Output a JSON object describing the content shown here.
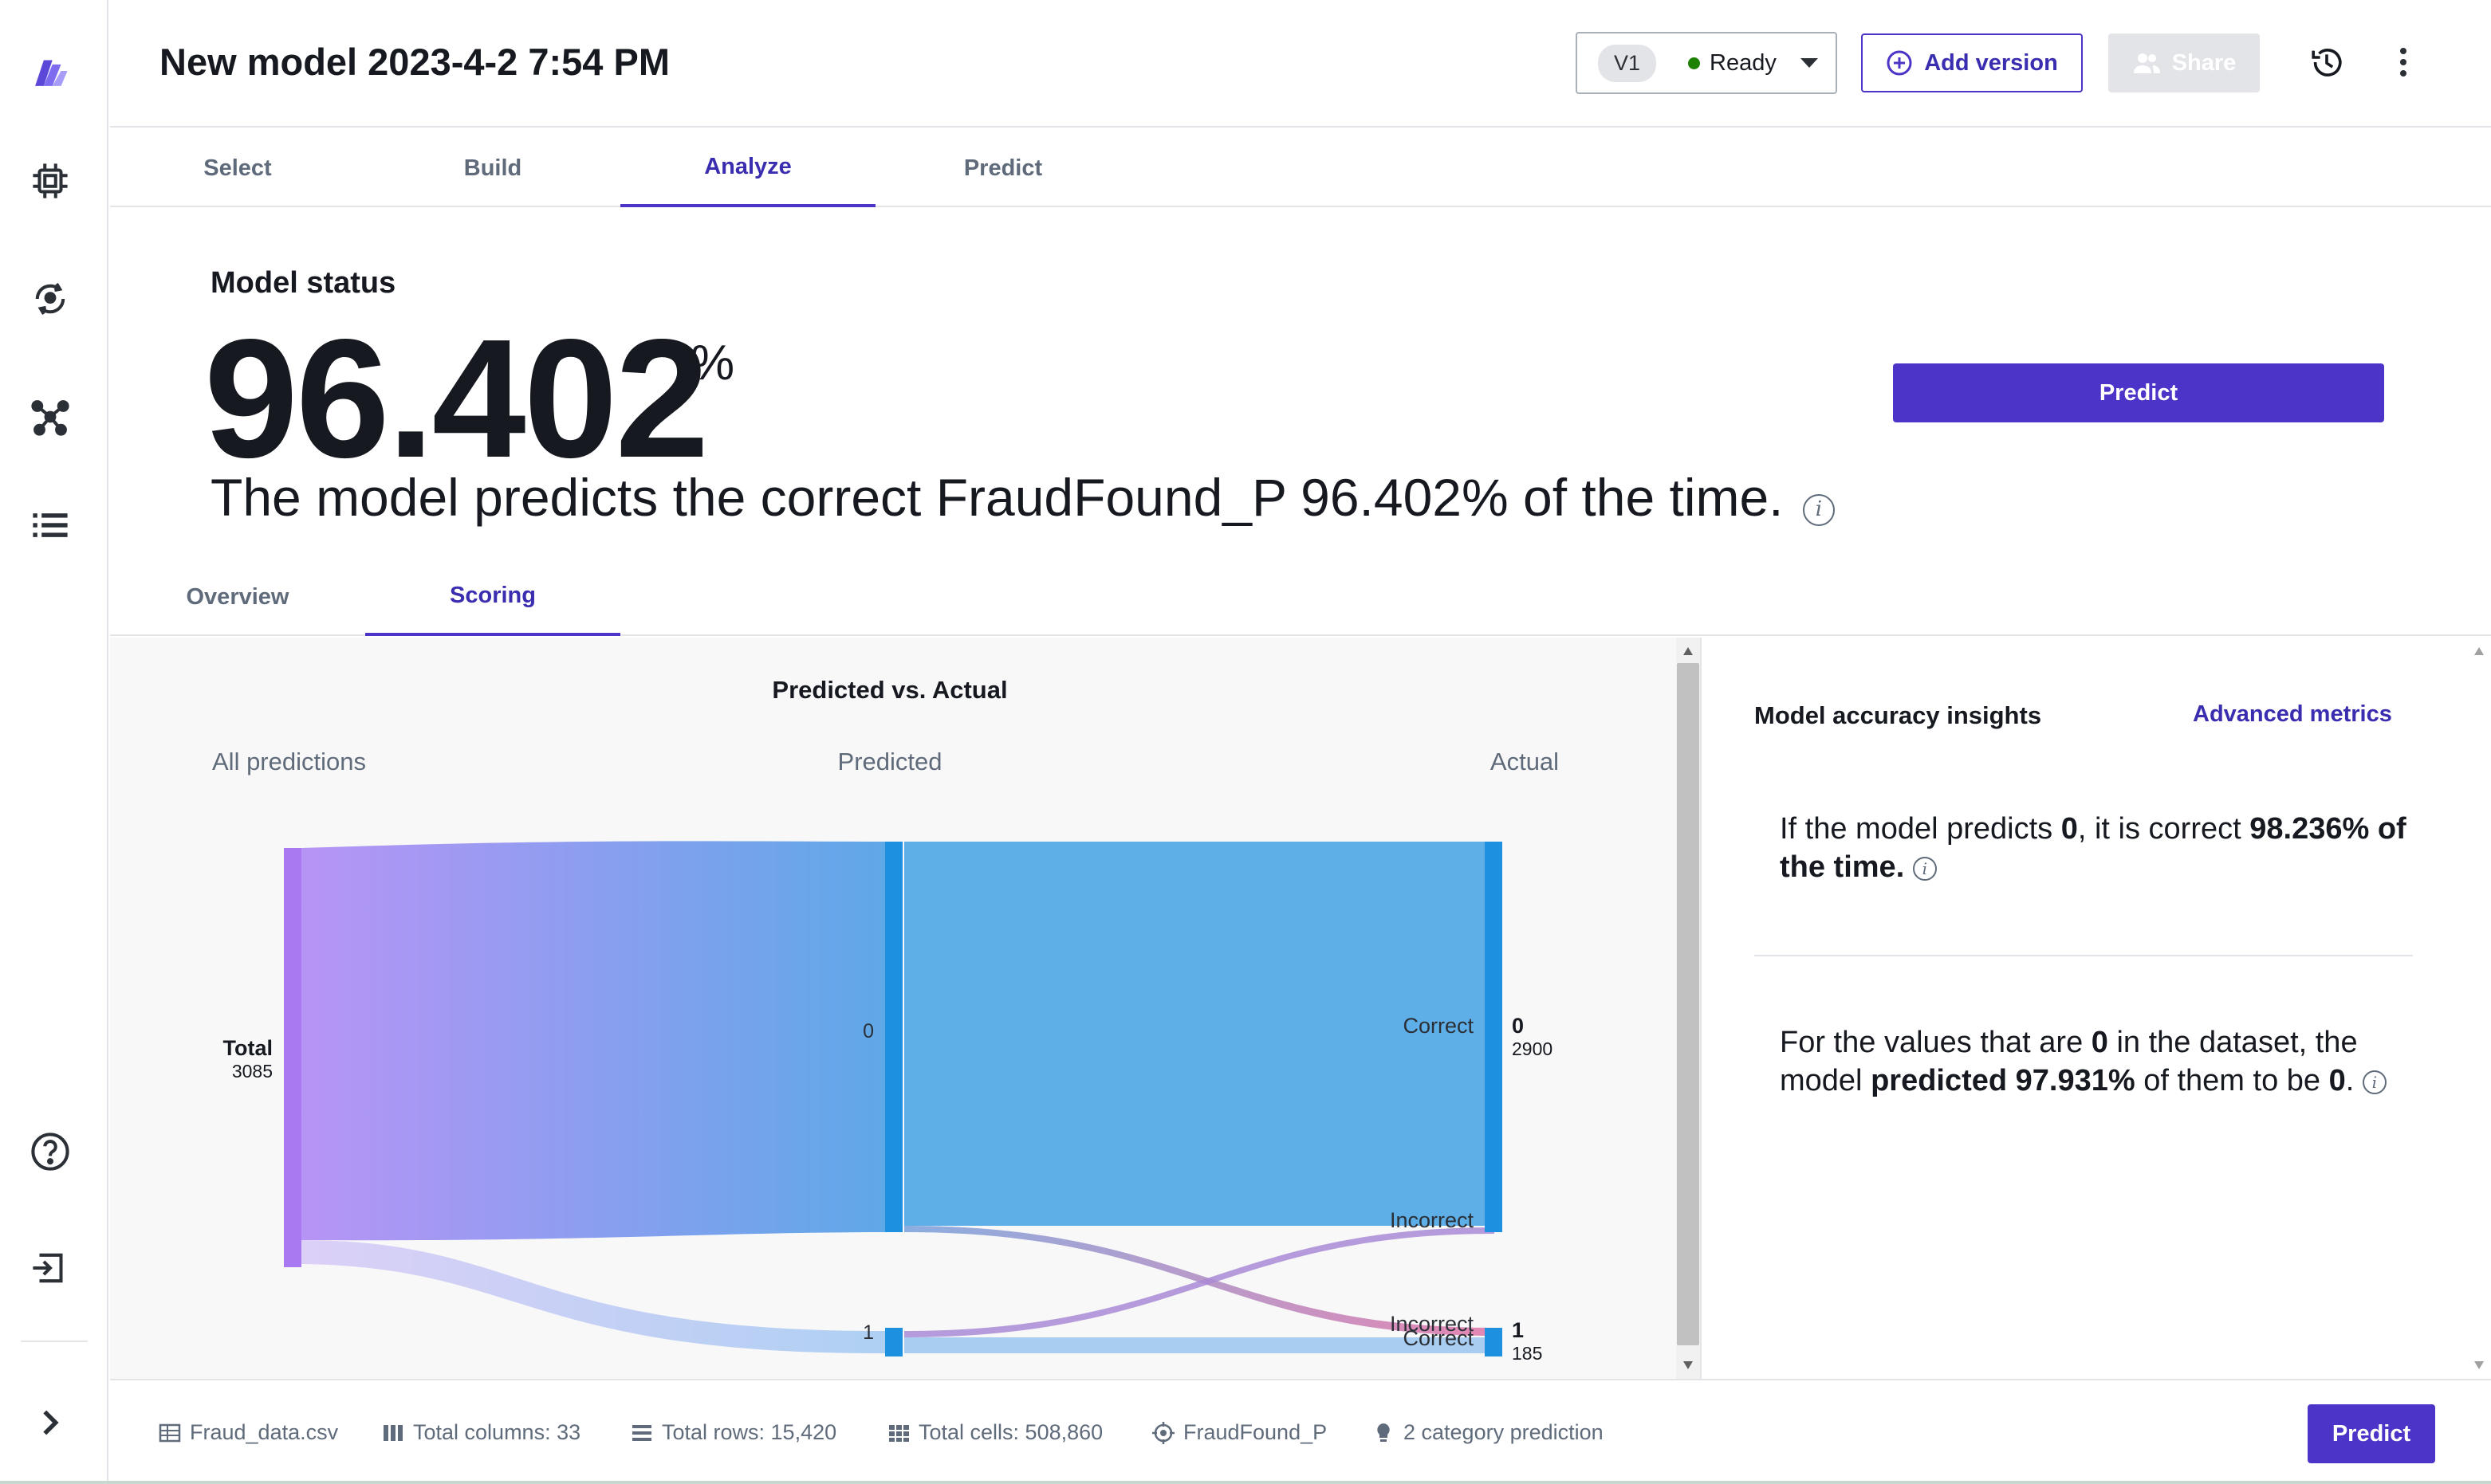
{
  "header": {
    "title": "New model 2023-4-2 7:54 PM",
    "version": "V1",
    "status": "Ready",
    "add_version_label": "Add version",
    "share_label": "Share"
  },
  "tabs": [
    {
      "label": "Select"
    },
    {
      "label": "Build"
    },
    {
      "label": "Analyze"
    },
    {
      "label": "Predict"
    }
  ],
  "model_status": {
    "label": "Model status",
    "accuracy": "96.402",
    "percent_symbol": "%",
    "sentence": "The model predicts the correct FraudFound_P 96.402% of the time.",
    "predict_label": "Predict"
  },
  "subtabs": [
    {
      "label": "Overview"
    },
    {
      "label": "Scoring"
    }
  ],
  "chart_data": {
    "type": "sankey",
    "title": "Predicted vs. Actual",
    "column_headers": [
      "All predictions",
      "Predicted",
      "Actual"
    ],
    "source": {
      "label": "Total",
      "value": 3085
    },
    "predicted_labels": [
      "0",
      "1"
    ],
    "actual": [
      {
        "label": "0",
        "value": 2900
      },
      {
        "label": "1",
        "value": 185
      }
    ],
    "flow_labels": {
      "correct_0": "Correct",
      "incorrect_0": "Incorrect",
      "incorrect_1": "Incorrect",
      "correct_1": "Correct"
    }
  },
  "insights": {
    "title": "Model accuracy insights",
    "advanced_link": "Advanced metrics",
    "insight1": {
      "p1": "If the model predicts ",
      "b1": "0",
      "p2": ", it is correct ",
      "b2": "98.236% of the time."
    },
    "insight2": {
      "p1": "For the values that are ",
      "b1": "0",
      "p2": " in the dataset, the model ",
      "b2": "predicted 97.931%",
      "p3": " of them to be ",
      "b3": "0",
      "p4": "."
    }
  },
  "footer": {
    "file": "Fraud_data.csv",
    "columns": "Total columns: 33",
    "rows": "Total rows: 15,420",
    "cells": "Total cells: 508,860",
    "target": "FraudFound_P",
    "prediction_type": "2 category prediction",
    "predict_label": "Predict"
  }
}
